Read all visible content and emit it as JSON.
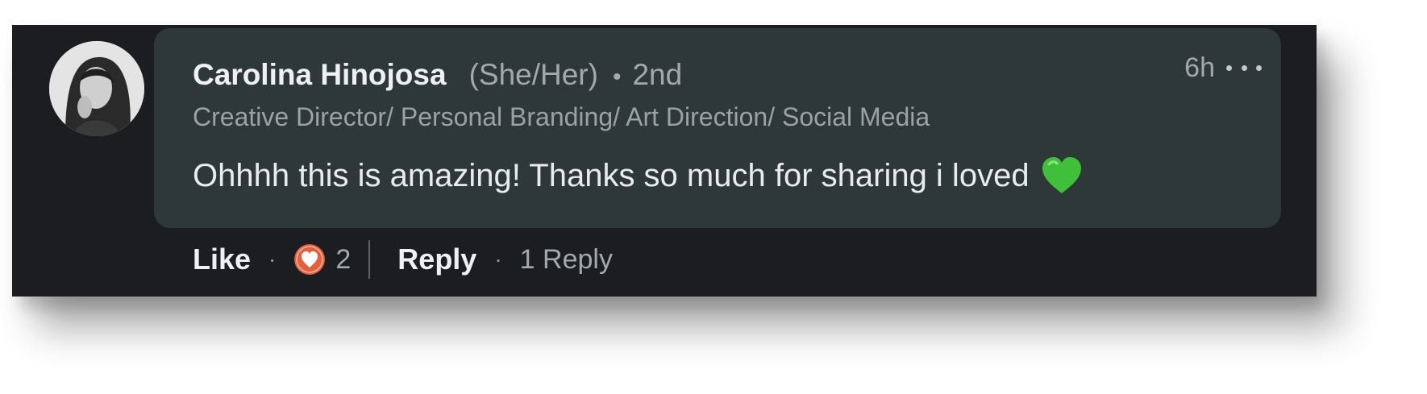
{
  "comment": {
    "author_name": "Carolina Hinojosa",
    "pronouns": "(She/Her)",
    "separator": "•",
    "connection_degree": "2nd",
    "headline": "Creative Director/ Personal Branding/ Art Direction/ Social Media",
    "text": "Ohhhh this is amazing! Thanks so much for sharing i loved",
    "emoji": "green-heart",
    "timestamp": "6h",
    "more_icon": "ellipsis-icon"
  },
  "actions": {
    "like_label": "Like",
    "dot": "·",
    "reaction_icon": "love-reaction-icon",
    "reaction_count": "2",
    "reply_label": "Reply",
    "reply_count_label": "1 Reply"
  },
  "colors": {
    "background": "#1b1d20",
    "bubble": "#2e3839",
    "reaction": "#e2603f",
    "emoji_green": "#3fbf3a"
  }
}
